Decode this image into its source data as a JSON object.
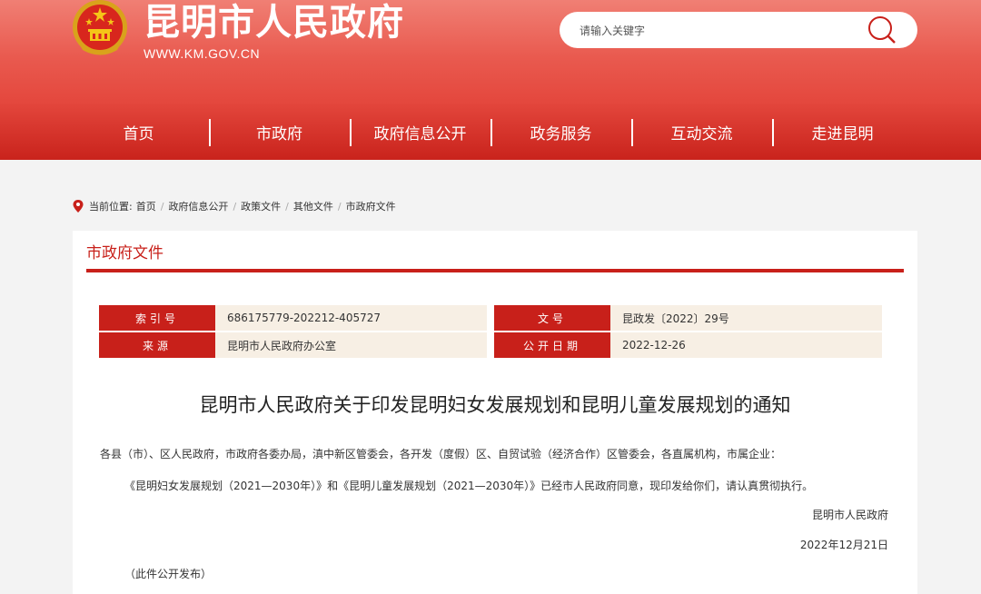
{
  "header": {
    "site_title": "昆明市人民政府",
    "site_url": "WWW.KM.GOV.CN",
    "emblem_icon": "national-emblem-icon"
  },
  "search": {
    "placeholder": "请输入关键字",
    "icon": "search-icon"
  },
  "nav": {
    "items": [
      "首页",
      "市政府",
      "政府信息公开",
      "政务服务",
      "互动交流",
      "走进昆明"
    ]
  },
  "breadcrumb": {
    "prefix": "当前位置:",
    "items": [
      "首页",
      "政府信息公开",
      "政策文件",
      "其他文件",
      "市政府文件"
    ]
  },
  "section": {
    "title": "市政府文件"
  },
  "meta": {
    "index_label": "索引号",
    "index_value": "686175779-202212-405727",
    "source_label": "来源",
    "source_value": "昆明市人民政府办公室",
    "doc_no_label": "文号",
    "doc_no_value": "昆政发〔2022〕29号",
    "date_label": "公开日期",
    "date_value": "2022-12-26"
  },
  "document": {
    "title": "昆明市人民政府关于印发昆明妇女发展规划和昆明儿童发展规划的通知",
    "recipients": "各县（市）、区人民政府，市政府各委办局，滇中新区管委会，各开发（度假）区、自贸试验（经济合作）区管委会，各直属机构，市属企业：",
    "body": "《昆明妇女发展规划（2021—2030年）》和《昆明儿童发展规划（2021—2030年）》已经市人民政府同意，现印发给你们，请认真贯彻执行。",
    "signature": "昆明市人民政府",
    "date": "2022年12月21日",
    "note": "（此件公开发布）"
  },
  "colors": {
    "brand_red": "#c8201a",
    "header_red": "#e95a4f",
    "meta_bg": "#f7efe4"
  }
}
